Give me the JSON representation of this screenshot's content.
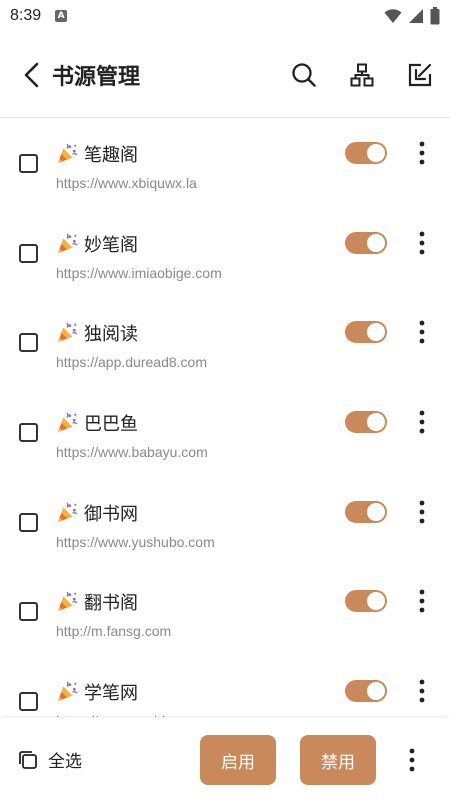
{
  "status_bar": {
    "time": "8:39",
    "indicator": "A"
  },
  "app_bar": {
    "title": "书源管理"
  },
  "sources": [
    {
      "name": "笔趣阁",
      "url": "https://www.xbiquwx.la",
      "enabled": true
    },
    {
      "name": "妙笔阁",
      "url": "https://www.imiaobige.com",
      "enabled": true
    },
    {
      "name": "独阅读",
      "url": "https://app.duread8.com",
      "enabled": true
    },
    {
      "name": "巴巴鱼",
      "url": "https://www.babayu.com",
      "enabled": true
    },
    {
      "name": "御书网",
      "url": "https://www.yushubo.com",
      "enabled": true
    },
    {
      "name": "翻书阁",
      "url": "http://m.fansg.com",
      "enabled": true
    },
    {
      "name": "学笔网",
      "url": "https://www.xuebiwang.com",
      "enabled": true
    }
  ],
  "bottom_bar": {
    "select_all_label": "全选",
    "enable_label": "启用",
    "disable_label": "禁用"
  },
  "colors": {
    "accent": "#c9895a",
    "text": "#222222",
    "subtext": "#8a8a8a"
  }
}
